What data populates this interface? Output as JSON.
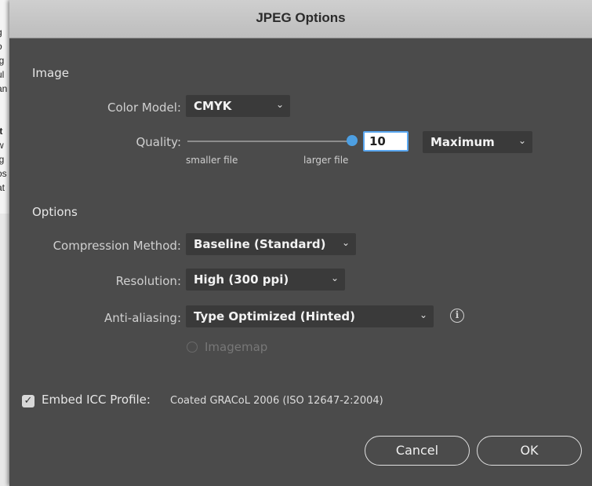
{
  "background_doc": {
    "lines": [
      "/",
      "g",
      "o",
      "ig",
      "ul",
      "an",
      "",
      "it",
      "w",
      "ig",
      "os",
      "at"
    ]
  },
  "dialog": {
    "title": "JPEG Options",
    "image_section": {
      "heading": "Image",
      "color_model_label": "Color Model:",
      "color_model_value": "CMYK",
      "quality_label": "Quality:",
      "quality_value": "10",
      "quality_preset": "Maximum",
      "smaller_file": "smaller file",
      "larger_file": "larger file",
      "quality_level": 1.0
    },
    "options_section": {
      "heading": "Options",
      "compression_label": "Compression Method:",
      "compression_value": "Baseline (Standard)",
      "resolution_label": "Resolution:",
      "resolution_value": "High (300 ppi)",
      "antialias_label": "Anti-aliasing:",
      "antialias_value": "Type Optimized (Hinted)",
      "imagemap_label": "Imagemap"
    },
    "icc": {
      "label": "Embed ICC Profile:",
      "profile": "Coated GRACoL 2006 (ISO 12647-2:2004)",
      "checked": true
    },
    "buttons": {
      "cancel": "Cancel",
      "ok": "OK"
    }
  },
  "colors": {
    "dialog_bg": "#4b4b4b",
    "accent": "#4d9fe2"
  }
}
